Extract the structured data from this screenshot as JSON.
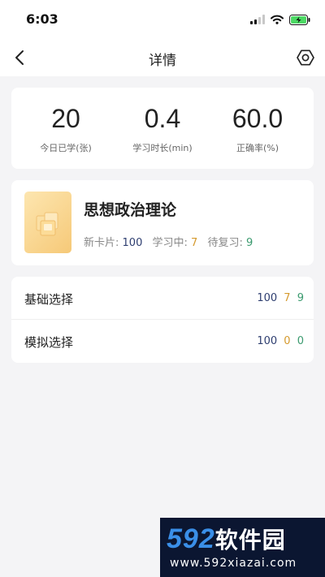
{
  "status_bar": {
    "time": "6:03"
  },
  "nav": {
    "title": "详情"
  },
  "stats": [
    {
      "value": "20",
      "label": "今日已学(张)"
    },
    {
      "value": "0.4",
      "label": "学习时长(min)"
    },
    {
      "value": "60.0",
      "label": "正确率(%)"
    }
  ],
  "course": {
    "title": "思想政治理论",
    "new_label": "新卡片:",
    "new_value": "100",
    "learning_label": "学习中:",
    "learning_value": "7",
    "review_label": "待复习:",
    "review_value": "9"
  },
  "sections": [
    {
      "label": "基础选择",
      "new": "100",
      "learning": "7",
      "review": "9"
    },
    {
      "label": "模拟选择",
      "new": "100",
      "learning": "0",
      "review": "0"
    }
  ],
  "watermark": {
    "number": "592",
    "text": "软件园",
    "url": "www.592xiazai.com"
  },
  "colors": {
    "blue": "#2e3e70",
    "orange": "#d59a2e",
    "green": "#3a9a6e"
  },
  "icons": {
    "back": "chevron-left-icon",
    "settings": "settings-icon"
  }
}
